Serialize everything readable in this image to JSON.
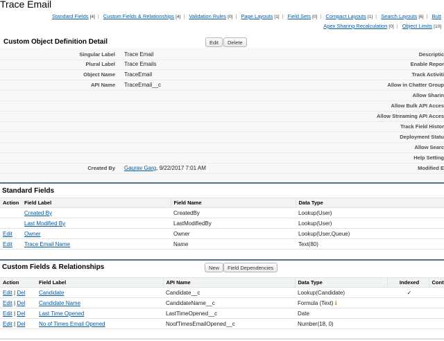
{
  "page": {
    "title": "Trace Email"
  },
  "jump_links": [
    {
      "label": "Standard Fields",
      "count": "[4]"
    },
    {
      "label": "Custom Fields & Relationships",
      "count": "[4]"
    },
    {
      "label": "Validation Rules",
      "count": "[0]"
    },
    {
      "label": "Page Layouts",
      "count": "[1]"
    },
    {
      "label": "Field Sets",
      "count": "[0]"
    },
    {
      "label": "Compact Layouts",
      "count": "[1]"
    },
    {
      "label": "Search Layouts",
      "count": "[6]"
    },
    {
      "label": "Butt",
      "count": ""
    },
    {
      "label": "Apex Sharing Recalculation",
      "count": "[0]"
    },
    {
      "label": "Object Limits",
      "count": "[10]"
    }
  ],
  "detail": {
    "title": "Custom Object Definition Detail",
    "edit_label": "Edit",
    "delete_label": "Delete",
    "left": [
      {
        "label": "Singular Label",
        "value": "Trace Email"
      },
      {
        "label": "Plural Label",
        "value": "Trace Emails"
      },
      {
        "label": "Object Name",
        "value": "TraceEmail"
      },
      {
        "label": "API Name",
        "value": "TraceEmail__c"
      }
    ],
    "right": [
      "Descriptic",
      "Enable Repor",
      "Track Activiti",
      "Allow in Chatter Group",
      "Allow Sharin",
      "Allow Bulk API Acces",
      "Allow Streaming API Acces",
      "Track Field Histor",
      "Deployment Statu",
      "Allow Searc",
      "Help Setting",
      "Modified E"
    ],
    "created_by_label": "Created By",
    "created_by_user": "Gaurav Garg",
    "created_by_date": ", 9/22/2017 7:01 AM"
  },
  "standard_fields": {
    "title": "Standard Fields",
    "columns": [
      "Action",
      "Field Label",
      "Field Name",
      "Data Type"
    ],
    "rows": [
      {
        "action": "",
        "label": "Created By",
        "name": "CreatedBy",
        "type": "Lookup(User)"
      },
      {
        "action": "",
        "label": "Last Modified By",
        "name": "LastModifiedBy",
        "type": "Lookup(User)"
      },
      {
        "action": "Edit",
        "label": "Owner",
        "name": "Owner",
        "type": "Lookup(User,Queue)"
      },
      {
        "action": "Edit",
        "label": "Trace Email Name",
        "name": "Name",
        "type": "Text(80)"
      }
    ]
  },
  "custom_fields": {
    "title": "Custom Fields & Relationships",
    "new_label": "New",
    "deps_label": "Field Dependencies",
    "columns": [
      "Action",
      "Field Label",
      "API Name",
      "Data Type",
      "Indexed",
      "Contr"
    ],
    "edit_label": "Edit",
    "del_label": "Del",
    "action_sep": " | ",
    "rows": [
      {
        "label": "Candidate",
        "api": "Candidate__c",
        "type": "Lookup(Candidate)",
        "indexed": "✓"
      },
      {
        "label": "Candidate Name",
        "api": "CandidateName__c",
        "type": "Formula (Text)",
        "indexed": ""
      },
      {
        "label": "Last Time Opened",
        "api": "LastTimeOpened__c",
        "type": "Date",
        "indexed": ""
      },
      {
        "label": "No of Times Email Opened",
        "api": "NoofTimesEmailOpened__c",
        "type": "Number(18, 0)",
        "indexed": ""
      }
    ]
  }
}
